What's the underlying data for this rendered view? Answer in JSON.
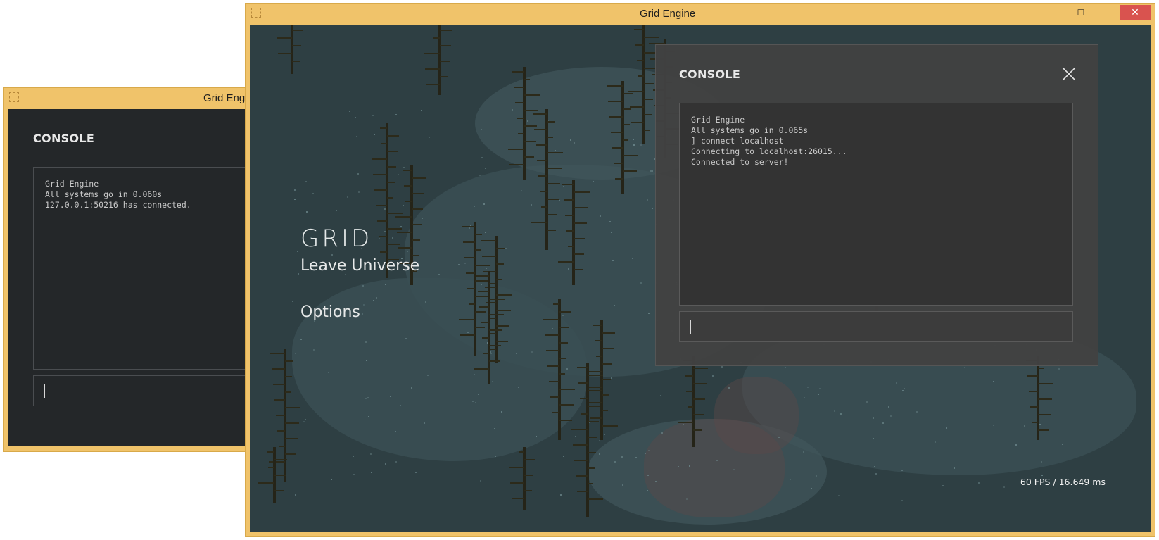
{
  "back_window": {
    "title": "Grid Engine",
    "console": {
      "title": "CONSOLE",
      "log": [
        "Grid Engine",
        "All systems go in 0.060s",
        "127.0.0.1:50216 has connected."
      ],
      "input_value": ""
    }
  },
  "front_window": {
    "title": "Grid Engine",
    "controls": {
      "minimize": "–",
      "maximize": "☐",
      "close": "✕"
    },
    "menu": {
      "logo": "GRID",
      "items": [
        "Leave Universe",
        "Options"
      ]
    },
    "console": {
      "title": "CONSOLE",
      "log": [
        "Grid Engine",
        "All systems go in 0.065s",
        "] connect localhost",
        "Connecting to localhost:26015...",
        "Connected to server!"
      ],
      "input_value": ""
    },
    "fps": "60 FPS / 16.649 ms"
  },
  "colors": {
    "titlebar": "#f0c36a",
    "close_button": "#d9534f",
    "scene_background": "#2e3f43",
    "console_bg": "#424242",
    "back_console_bg": "#242729"
  }
}
